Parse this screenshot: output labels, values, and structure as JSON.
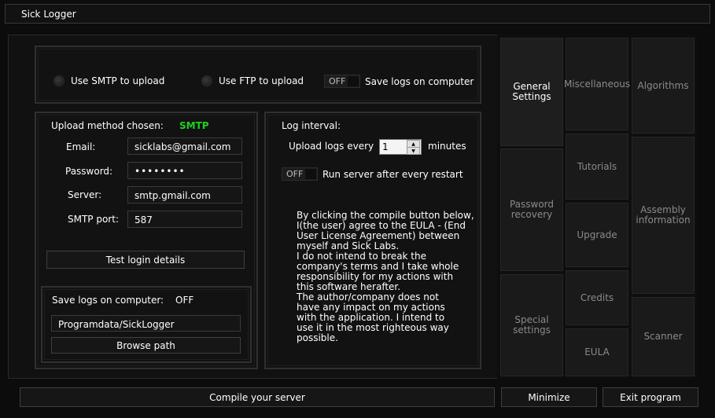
{
  "window": {
    "title": "Sick Logger"
  },
  "upload_options": {
    "smtp_label": "Use SMTP to upload",
    "ftp_label": "Use FTP to upload",
    "save_toggle_state": "OFF",
    "save_label": "Save logs on computer"
  },
  "smtp": {
    "method_label": "Upload method chosen:",
    "method_value": "SMTP",
    "email_label": "Email:",
    "email_value": "sicklabs@gmail.com",
    "password_label": "Password:",
    "password_value": "••••••••",
    "server_label": "Server:",
    "server_value": "smtp.gmail.com",
    "port_label": "SMTP port:",
    "port_value": "587",
    "test_button": "Test login details"
  },
  "save_logs": {
    "label": "Save logs on computer:",
    "state": "OFF",
    "path_value": "Programdata/SickLogger",
    "browse_button": "Browse path"
  },
  "log": {
    "interval_label": "Log interval:",
    "upload_every_label": "Upload logs every",
    "interval_value": "1",
    "minutes_label": "minutes",
    "restart_toggle_state": "OFF",
    "restart_label": "Run server after every restart",
    "eula_text": "By clicking the compile button below,\nI(the user) agree to the EULA - (End\nUser License Agreement) between\nmyself and Sick Labs.\n     I do not intend to break the\ncompany's terms and I take whole\nresponsibility for my actions with\nthis software herafter.\n     The author/company does not\nhave any impact on my actions\nwith the application. I intend to\nuse it in the most righteous way\npossible."
  },
  "tiles": {
    "general": "General\nSettings",
    "misc": "Miscellaneous",
    "algorithms": "Algorithms",
    "tutorials": "Tutorials",
    "password_recovery": "Password\nrecovery",
    "assembly": "Assembly\ninformation",
    "upgrade": "Upgrade",
    "credits": "Credits",
    "special": "Special\nsettings",
    "eula": "EULA",
    "scanner": "Scanner"
  },
  "bottom": {
    "compile": "Compile your server",
    "minimize": "Minimize",
    "exit": "Exit program"
  }
}
